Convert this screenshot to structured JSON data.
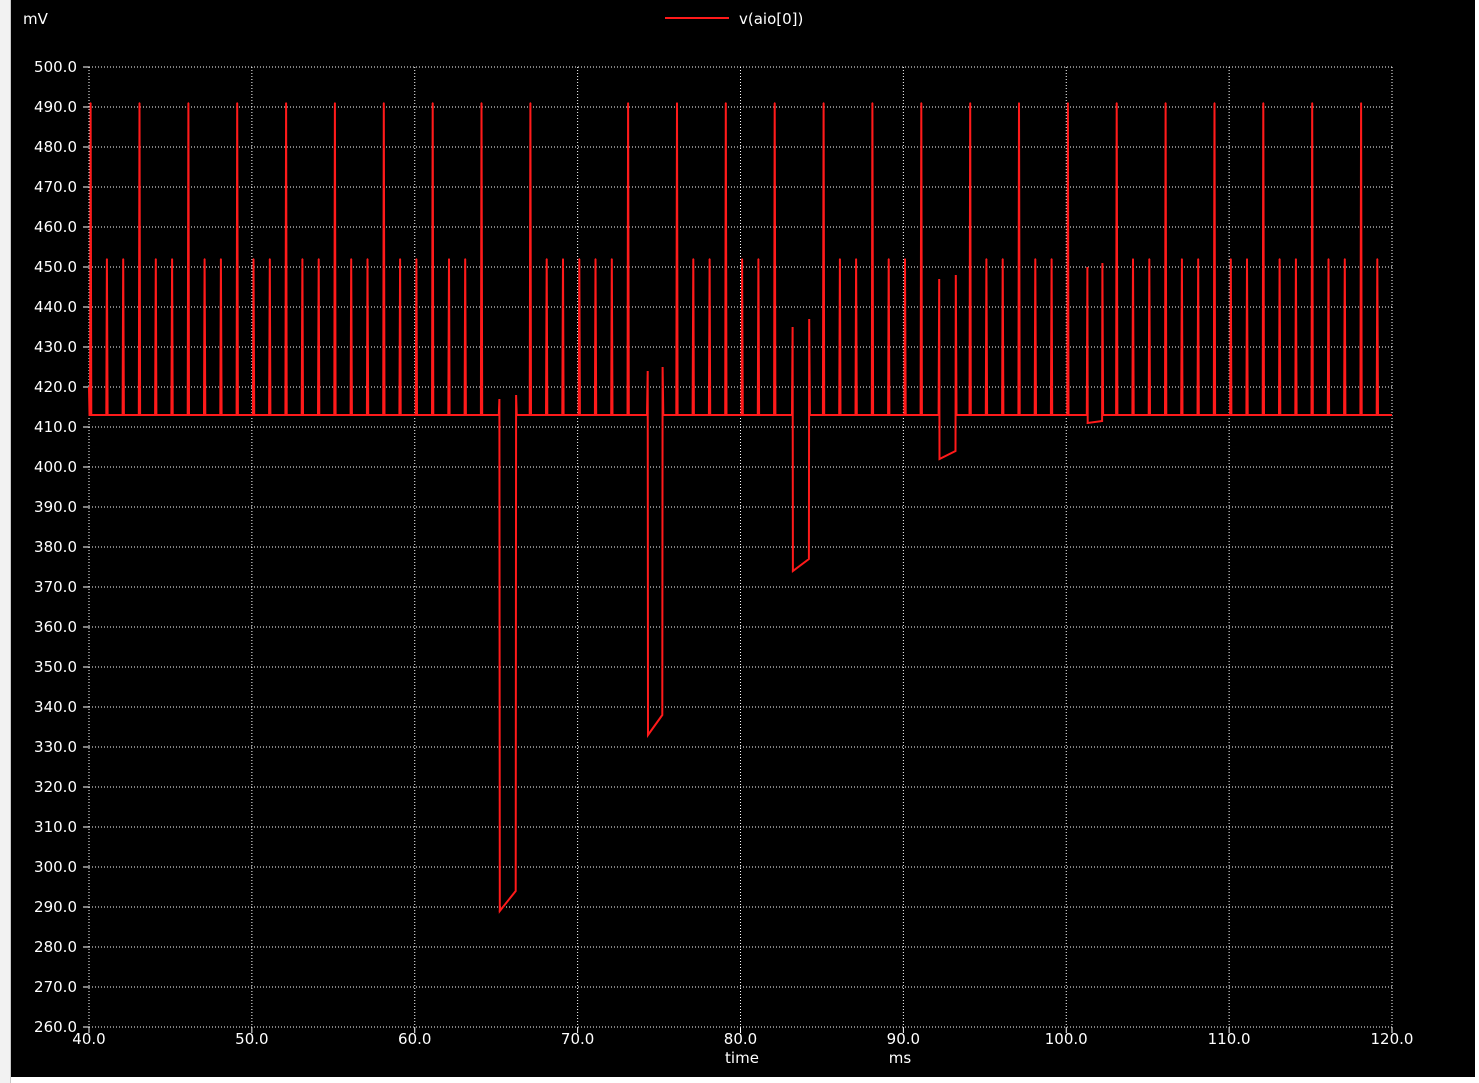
{
  "chart_data": {
    "type": "line",
    "legend": {
      "label": "v(aio[0])",
      "color": "#ff1a1a",
      "placement": "top-center"
    },
    "y_unit": "mV",
    "x_unit": "ms",
    "xlabel": "time",
    "xlim": [
      40,
      120
    ],
    "ylim": [
      260,
      500
    ],
    "x_ticks": [
      "40.0",
      "50.0",
      "60.0",
      "70.0",
      "80.0",
      "90.0",
      "100.0",
      "110.0",
      "120.0"
    ],
    "y_ticks": [
      "500.0",
      "490.0",
      "480.0",
      "470.0",
      "460.0",
      "450.0",
      "440.0",
      "430.0",
      "420.0",
      "410.0",
      "400.0",
      "390.0",
      "380.0",
      "370.0",
      "360.0",
      "350.0",
      "340.0",
      "330.0",
      "320.0",
      "310.0",
      "300.0",
      "290.0",
      "280.0",
      "270.0",
      "260.0"
    ],
    "grid": true,
    "background": "#000000",
    "trace_color": "#ff1a1a",
    "series": [
      {
        "name": "v(aio[0])",
        "baseline": 413,
        "spikes": [
          [
            40.1,
            491
          ],
          [
            41.1,
            452
          ],
          [
            42.1,
            452
          ],
          [
            43.1,
            491
          ],
          [
            44.1,
            452
          ],
          [
            45.1,
            452
          ],
          [
            46.1,
            491
          ],
          [
            47.1,
            452
          ],
          [
            48.1,
            452
          ],
          [
            49.1,
            491
          ],
          [
            50.1,
            452
          ],
          [
            51.1,
            452
          ],
          [
            52.1,
            491
          ],
          [
            53.1,
            452
          ],
          [
            54.1,
            452
          ],
          [
            55.1,
            491
          ],
          [
            56.1,
            452
          ],
          [
            57.1,
            452
          ],
          [
            58.1,
            491
          ],
          [
            59.1,
            452
          ],
          [
            60.1,
            452
          ],
          [
            61.1,
            491
          ],
          [
            62.1,
            452
          ],
          [
            63.1,
            452
          ],
          [
            64.1,
            491
          ],
          [
            67.1,
            491
          ],
          [
            68.1,
            452
          ],
          [
            69.1,
            452
          ],
          [
            70.1,
            452
          ],
          [
            71.1,
            452
          ],
          [
            72.1,
            452
          ],
          [
            73.1,
            491
          ],
          [
            76.1,
            491
          ],
          [
            77.1,
            452
          ],
          [
            78.1,
            452
          ],
          [
            79.1,
            491
          ],
          [
            80.1,
            452
          ],
          [
            81.1,
            452
          ],
          [
            82.1,
            491
          ],
          [
            85.1,
            491
          ],
          [
            86.1,
            452
          ],
          [
            87.1,
            452
          ],
          [
            88.1,
            491
          ],
          [
            89.1,
            452
          ],
          [
            90.1,
            452
          ],
          [
            91.1,
            491
          ],
          [
            94.1,
            491
          ],
          [
            95.1,
            452
          ],
          [
            96.1,
            452
          ],
          [
            97.1,
            491
          ],
          [
            98.1,
            452
          ],
          [
            99.1,
            452
          ],
          [
            100.1,
            491
          ],
          [
            103.1,
            491
          ],
          [
            104.1,
            452
          ],
          [
            105.1,
            452
          ],
          [
            106.1,
            491
          ],
          [
            107.1,
            452
          ],
          [
            108.1,
            452
          ],
          [
            109.1,
            491
          ],
          [
            110.1,
            452
          ],
          [
            111.1,
            452
          ],
          [
            112.1,
            491
          ],
          [
            113.1,
            452
          ],
          [
            114.1,
            452
          ],
          [
            115.1,
            491
          ],
          [
            116.1,
            452
          ],
          [
            117.1,
            452
          ],
          [
            118.1,
            491
          ],
          [
            119.1,
            452
          ]
        ],
        "dips": [
          {
            "start": 65.2,
            "end": 66.2,
            "low_start": 289,
            "low_end": 294,
            "pre_peak": 417,
            "post_peak": 418
          },
          {
            "start": 74.3,
            "end": 75.2,
            "low_start": 333,
            "low_end": 338,
            "pre_peak": 424,
            "post_peak": 425
          },
          {
            "start": 83.2,
            "end": 84.2,
            "low_start": 374,
            "low_end": 377,
            "pre_peak": 435,
            "post_peak": 437
          },
          {
            "start": 92.2,
            "end": 93.2,
            "low_start": 402,
            "low_end": 404,
            "pre_peak": 447,
            "post_peak": 448
          },
          {
            "start": 101.3,
            "end": 102.2,
            "low_start": 411,
            "low_end": 411.5,
            "pre_peak": 450,
            "post_peak": 451
          }
        ]
      }
    ]
  }
}
